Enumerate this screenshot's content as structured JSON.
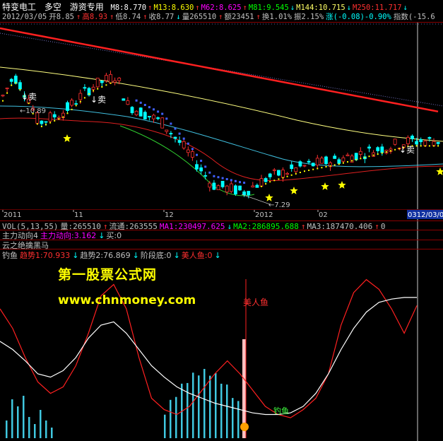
{
  "header": {
    "stock_name": "特变电工",
    "tab_duokong": "多空",
    "tab_formula": "游资专用",
    "ma_line": [
      {
        "text": "M8:8.770",
        "color": "#ffffff"
      },
      {
        "text": "↑",
        "color": "#ff3030"
      },
      {
        "text": "M13:8.630",
        "color": "#ffff00"
      },
      {
        "text": "↑",
        "color": "#ff3030"
      },
      {
        "text": "M62:8.625",
        "color": "#ff00ff"
      },
      {
        "text": "↑",
        "color": "#ff3030"
      },
      {
        "text": "M81:9.545",
        "color": "#00ff00"
      },
      {
        "text": "↓",
        "color": "#00ffff"
      },
      {
        "text": "M144:10.715",
        "color": "#ffff66"
      },
      {
        "text": "↓",
        "color": "#00ffff"
      },
      {
        "text": "M250:11.717",
        "color": "#ff3030"
      },
      {
        "text": "↓",
        "color": "#00ffff"
      }
    ]
  },
  "ohlc_bar": [
    {
      "text": "2012/03/05",
      "color": "#c0c0c0"
    },
    {
      "text": "开8.85",
      "color": "#c0c0c0"
    },
    {
      "text": "↑",
      "color": "#ff3030"
    },
    {
      "text": "高8.93",
      "color": "#ff3030"
    },
    {
      "text": "↑",
      "color": "#ff3030"
    },
    {
      "text": "低8.74",
      "color": "#c0c0c0"
    },
    {
      "text": "↑",
      "color": "#ff3030"
    },
    {
      "text": "收8.77",
      "color": "#c0c0c0"
    },
    {
      "text": "↓",
      "color": "#00ffff"
    },
    {
      "text": "量265510",
      "color": "#c0c0c0"
    },
    {
      "text": "↑",
      "color": "#ff3030"
    },
    {
      "text": "额23451",
      "color": "#c0c0c0"
    },
    {
      "text": "↑",
      "color": "#ff3030"
    },
    {
      "text": "换1.01%",
      "color": "#c0c0c0"
    },
    {
      "text": "振2.15%",
      "color": "#c0c0c0"
    },
    {
      "text": "涨(-0.08)-0.90%",
      "color": "#00ffff"
    },
    {
      "text": "指数(-15.6",
      "color": "#c0c0c0"
    }
  ],
  "main_chart": {
    "annotations": {
      "sell_1": "↓卖",
      "sell_2": "↓卖",
      "sell_3": "↓卖",
      "high_label": "←10.89",
      "low_label": "←7.29"
    },
    "x_ticks": [
      "2011",
      "11",
      "12",
      "2012",
      "02",
      "03",
      "12/03/0"
    ]
  },
  "volume_panel": {
    "label_items": [
      {
        "text": "VOL(5,13,55)",
        "color": "#c0c0c0"
      },
      {
        "text": "量:265510",
        "color": "#c0c0c0"
      },
      {
        "text": "↑",
        "color": "#ff3030"
      },
      {
        "text": "流通:263555",
        "color": "#c0c0c0"
      },
      {
        "text": "MA1:230497.625",
        "color": "#ff00ff"
      },
      {
        "text": "↓",
        "color": "#00ffff"
      },
      {
        "text": "MA2:286895.688",
        "color": "#00ff00"
      },
      {
        "text": "↑",
        "color": "#ff3030"
      },
      {
        "text": "MA3:187470.406",
        "color": "#c0c0c0"
      },
      {
        "text": "↑",
        "color": "#ff3030"
      },
      {
        "text": "0",
        "color": "#c0c0c0"
      }
    ]
  },
  "main_force_panel": {
    "label_items": [
      {
        "text": "主力动向4",
        "color": "#c0c0c0"
      },
      {
        "text": "主力动向:3.162",
        "color": "#ff00ff"
      },
      {
        "text": "↓",
        "color": "#00ffff"
      },
      {
        "text": "买:0",
        "color": "#c0c0c0"
      }
    ]
  },
  "cloud_panel": {
    "label": "云之绝擒黑马"
  },
  "fishing_panel": {
    "label_items": [
      {
        "text": "钓鱼",
        "color": "#c0c0c0"
      },
      {
        "text": "趋势1:70.933",
        "color": "#ff3030"
      },
      {
        "text": "↓",
        "color": "#00ffff"
      },
      {
        "text": "趋势2:76.869",
        "color": "#c0c0c0"
      },
      {
        "text": "↓",
        "color": "#00ffff"
      },
      {
        "text": "阶段底:0",
        "color": "#c0c0c0"
      },
      {
        "text": "↓",
        "color": "#00ffff"
      },
      {
        "text": "美人鱼:0",
        "color": "#ff3030"
      },
      {
        "text": "↓",
        "color": "#00ffff"
      }
    ],
    "mermaid_label": "美人鱼",
    "fishing_label": "钓鱼",
    "watermark_1": "第一股票公式网",
    "watermark_2": "www.chnmoney.com"
  },
  "colors": {
    "up": "#ff3030",
    "down": "#00ffff",
    "ma250": "#ff2020",
    "ma144": "#ffff80",
    "ma81": "#40c0e0",
    "trend1": "#ff2020",
    "trend2": "#ffffff",
    "bars": "#40c8e0"
  },
  "chart_data": {
    "type": "line",
    "title": "特变电工",
    "series": [
      {
        "name": "趋势1",
        "values": [
          70,
          58,
          40,
          25,
          18,
          22,
          35,
          55,
          78,
          85,
          70,
          40,
          15,
          8,
          5,
          10,
          20,
          30,
          38,
          30,
          20,
          10,
          5,
          3,
          8,
          15,
          30,
          60,
          80,
          88,
          82,
          70,
          55,
          72
        ]
      },
      {
        "name": "趋势2",
        "values": [
          50,
          45,
          38,
          30,
          28,
          32,
          40,
          52,
          60,
          62,
          55,
          45,
          35,
          28,
          22,
          18,
          15,
          12,
          10,
          8,
          6,
          5,
          5,
          6,
          10,
          18,
          30,
          45,
          58,
          68,
          74,
          76,
          77,
          77
        ]
      }
    ],
    "price_low": 7.29,
    "price_high": 10.89
  }
}
